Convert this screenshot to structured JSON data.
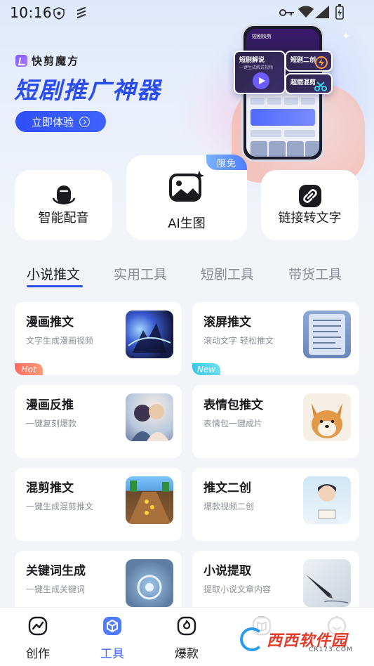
{
  "status_bar": {
    "time": "10:16"
  },
  "hero": {
    "brand_name": "快剪魔方",
    "headline": "短剧推广神器",
    "cta_label": "立即体验",
    "phone_mock": {
      "title": "短剧快剪",
      "cards": [
        {
          "title": "短剧解说",
          "subtitle": "一键生成解说视频"
        },
        {
          "title": "短剧二创"
        },
        {
          "title": "超燃混剪"
        }
      ]
    }
  },
  "quick_tools": [
    {
      "label": "智能配音",
      "icon": "microphone-icon"
    },
    {
      "label": "AI生图",
      "icon": "image-sparkle-icon",
      "badge": "限免"
    },
    {
      "label": "链接转文字",
      "icon": "link-icon"
    }
  ],
  "tabs": [
    {
      "label": "小说推文",
      "active": true
    },
    {
      "label": "实用工具",
      "active": false
    },
    {
      "label": "短剧工具",
      "active": false
    },
    {
      "label": "带货工具",
      "active": false
    }
  ],
  "cards": [
    {
      "title": "漫画推文",
      "subtitle": "文字生成漫画视频",
      "badge": "Hot",
      "thumb": "anime-warrior"
    },
    {
      "title": "滚屏推文",
      "subtitle": "滚动文字 轻松推文",
      "badge": "New",
      "thumb": "text-page"
    },
    {
      "title": "漫画反推",
      "subtitle": "一键复刻爆款",
      "thumb": "anime-couple"
    },
    {
      "title": "表情包推文",
      "subtitle": "表情包一键成片",
      "thumb": "shiba-dog"
    },
    {
      "title": "混剪推文",
      "subtitle": "一键生成混剪推文",
      "thumb": "game-runner"
    },
    {
      "title": "推文二创",
      "subtitle": "爆款视频二创",
      "thumb": "anime-boy-reading"
    },
    {
      "title": "关键词生成",
      "subtitle": "一键生成关键词",
      "thumb": "key-glow"
    },
    {
      "title": "小说提取",
      "subtitle": "提取小说文章内容",
      "thumb": "pen-writing"
    }
  ],
  "bottom_nav": [
    {
      "label": "创作",
      "icon": "chart-line-icon",
      "active": false
    },
    {
      "label": "工具",
      "icon": "cube-icon",
      "active": true
    },
    {
      "label": "爆款",
      "icon": "fire-icon",
      "active": false
    },
    {
      "label": "",
      "icon": "book-icon",
      "active": false
    },
    {
      "label": "",
      "icon": "smile-icon",
      "active": false
    }
  ],
  "watermark": {
    "text": "西西软件园",
    "sub": "CR173.COM"
  },
  "colors": {
    "accent": "#2f4ff5",
    "hot": "#ff6a5c",
    "new": "#37c6e6"
  }
}
